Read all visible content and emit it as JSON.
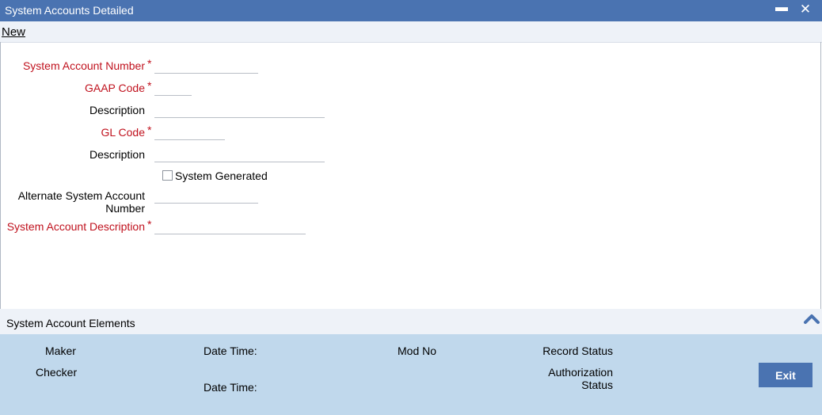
{
  "window": {
    "title": "System Accounts Detailed",
    "minimize_glyph": "▬",
    "close_glyph": "✕"
  },
  "menu": {
    "new_label": "New"
  },
  "form": {
    "system_account_number": {
      "label": "System Account Number",
      "value": ""
    },
    "gaap_code": {
      "label": "GAAP Code",
      "value": ""
    },
    "description_1": {
      "label": "Description",
      "value": ""
    },
    "gl_code": {
      "label": "GL Code",
      "value": ""
    },
    "description_2": {
      "label": "Description",
      "value": ""
    },
    "system_generated": {
      "label": "System Generated",
      "checked": false
    },
    "alternate_system_account_number": {
      "label_line1": "Alternate System Account",
      "label_line2": "Number",
      "value": ""
    },
    "system_account_description": {
      "label": "System Account Description",
      "value": ""
    },
    "required_marker": "*"
  },
  "elements_section": {
    "label": "System Account Elements",
    "icon": "chevron-up-icon"
  },
  "footer": {
    "maker": "Maker",
    "checker": "Checker",
    "date_time_1": "Date Time:",
    "date_time_2": "Date Time:",
    "mod_no": "Mod No",
    "record_status": "Record Status",
    "authorization_status_line1": "Authorization",
    "authorization_status_line2": "Status",
    "exit_label": "Exit"
  },
  "colors": {
    "titlebar": "#4a73b1",
    "required_label": "#c0121e",
    "footer_bg": "#c0d8ec",
    "exit_button": "#4a73b1"
  }
}
